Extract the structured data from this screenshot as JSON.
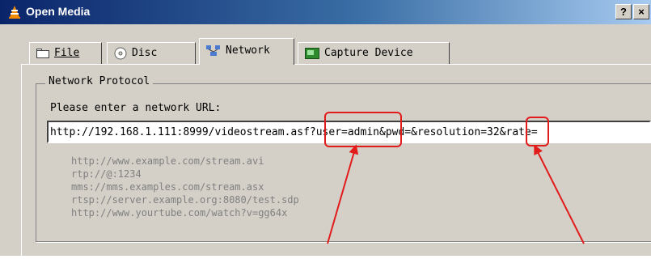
{
  "window": {
    "title": "Open Media",
    "help_label": "?",
    "close_label": "×"
  },
  "tabs": [
    {
      "label": "File",
      "icon": "file-icon"
    },
    {
      "label": "Disc",
      "icon": "disc-icon"
    },
    {
      "label": "Network",
      "icon": "network-icon",
      "active": true
    },
    {
      "label": "Capture Device",
      "icon": "capture-icon"
    }
  ],
  "network": {
    "group_title": "Network Protocol",
    "prompt": "Please enter a network URL:",
    "url_value": "http://192.168.1.111:8999/videostream.asf?user=admin&pwd=&resolution=32&rate=",
    "examples": [
      "http://www.example.com/stream.avi",
      "rtp://@:1234",
      "mms://mms.examples.com/stream.asx",
      "rtsp://server.example.org:8080/test.sdp",
      "http://www.yourtube.com/watch?v=gg64x"
    ]
  },
  "colors": {
    "annotation": "#e21b1b",
    "titlebar_start": "#0a246a",
    "titlebar_end": "#a6caf0"
  }
}
